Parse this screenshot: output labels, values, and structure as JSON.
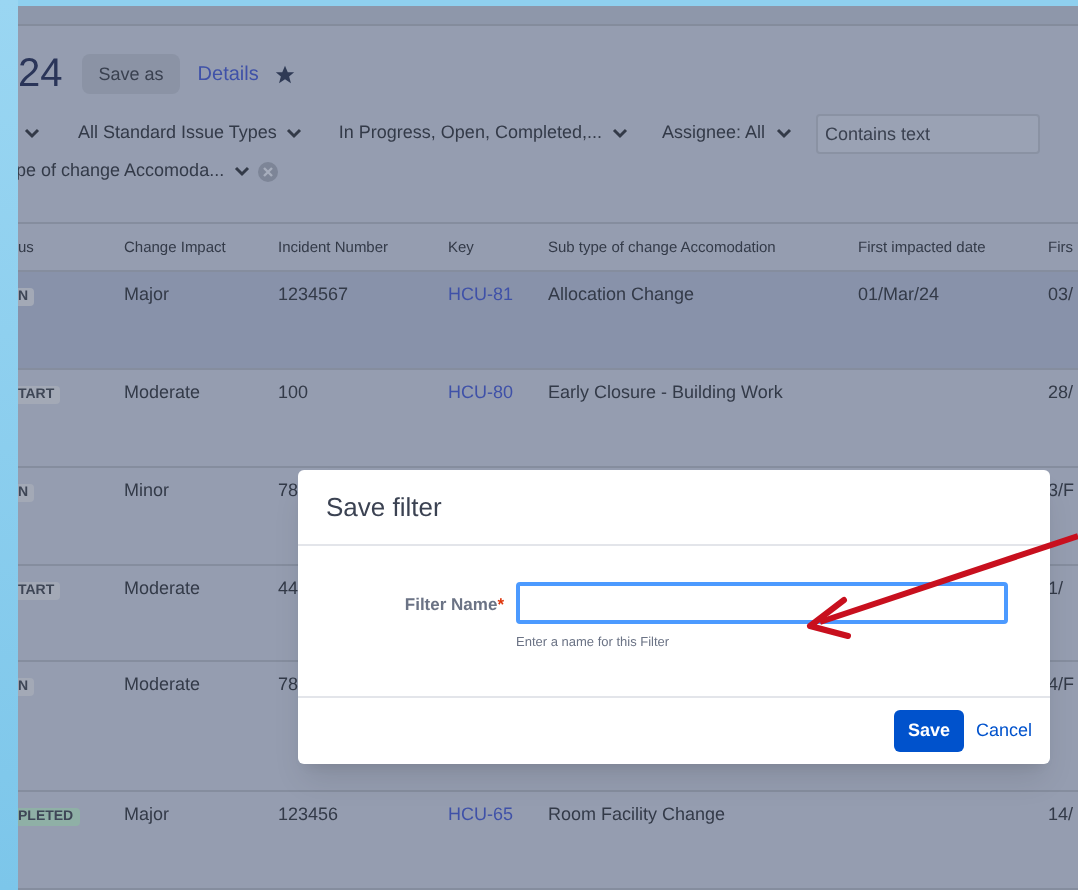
{
  "header": {
    "title": "24",
    "save_as": "Save as",
    "details": "Details"
  },
  "filters": [
    {
      "label": "All Standard Issue Types"
    },
    {
      "label": "In Progress, Open, Completed,..."
    },
    {
      "label": "Assignee: All"
    }
  ],
  "search": {
    "placeholder": "Contains text"
  },
  "subtype_filter": {
    "label": "pe of change Accomoda..."
  },
  "table": {
    "columns": [
      "us",
      "Change Impact",
      "Incident Number",
      "Key",
      "Sub type of change Accomodation",
      "First impacted date",
      "Firs"
    ],
    "rows": [
      {
        "selected": true,
        "status": {
          "text": "N",
          "color": "#a3a9b6"
        },
        "impact": "Major",
        "incident": "1234567",
        "key": "HCU-81",
        "subtype": "Allocation Change",
        "first_date": "01/Mar/24",
        "column_7": "03/"
      },
      {
        "selected": false,
        "status": {
          "text": "TART",
          "color": "#a3a9b6"
        },
        "impact": "Moderate",
        "incident": "100",
        "key": "HCU-80",
        "subtype": "Early Closure - Building Work",
        "column_7": "28/"
      },
      {
        "selected": false,
        "status": {
          "text": "N",
          "color": "#a3a9b6"
        },
        "impact": "Minor",
        "incident": "78",
        "column_7": "3/F"
      },
      {
        "selected": false,
        "status": {
          "text": "TART",
          "color": "#a3a9b6"
        },
        "impact": "Moderate",
        "incident": "44",
        "column_7": "1/"
      },
      {
        "selected": false,
        "status": {
          "text": "N",
          "color": "#a3a9b6"
        },
        "impact": "Moderate",
        "incident": "78",
        "column_7": "4/F"
      },
      {
        "selected": false,
        "status": {
          "text": "PLETED",
          "color": "#8fb0a6"
        },
        "impact": "Major",
        "incident": "123456",
        "key": "HCU-65",
        "subtype": "Room Facility Change",
        "column_7": "14/"
      }
    ]
  },
  "dialog": {
    "title": "Save filter",
    "field_label": "Filter Name",
    "required_mark": "*",
    "hint": "Enter a name for this Filter",
    "save": "Save",
    "cancel": "Cancel"
  }
}
